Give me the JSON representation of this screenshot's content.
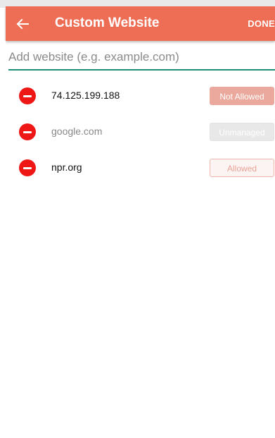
{
  "header": {
    "title": "Custom Website",
    "done_label": "DONE",
    "back_icon": "arrow-left-icon",
    "background_color": "#ee6d55"
  },
  "search": {
    "placeholder": "Add website (e.g. example.com)",
    "value": "",
    "underline_color": "#1f8f7a"
  },
  "websites": [
    {
      "label": "74.125.199.188",
      "status": "Not Allowed",
      "status_key": "not-allowed"
    },
    {
      "label": "google.com",
      "status": "Unmanaged",
      "status_key": "unmanaged"
    },
    {
      "label": "npr.org",
      "status": "Allowed",
      "status_key": "allowed"
    }
  ],
  "icons": {
    "remove": "remove-circle-icon"
  },
  "colors": {
    "remove_icon": "#ef1616",
    "not_allowed": "#eaa99c",
    "unmanaged": "#e8e8e8",
    "allowed_border": "#eeb7ad"
  }
}
